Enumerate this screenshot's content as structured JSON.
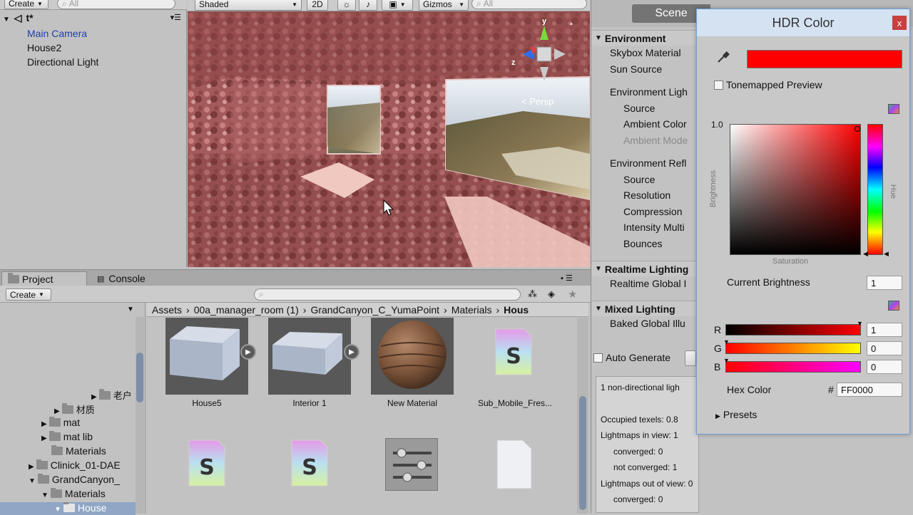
{
  "hierarchy": {
    "create_label": "Create",
    "search_placeholder": "All",
    "scene_name": "t*",
    "items": [
      {
        "label": "Main Camera",
        "color": "#111111"
      },
      {
        "label": "House2",
        "color": "#1f3fb0"
      },
      {
        "label": "Directional Light",
        "color": "#111111"
      }
    ]
  },
  "scene_toolbar": {
    "shading": "Shaded",
    "mode_2d": "2D",
    "gizmos": "Gizmos",
    "search_placeholder": "All"
  },
  "viewport": {
    "persp_label": "Persp",
    "axis_y": "y",
    "axis_z": "z"
  },
  "project": {
    "tab_project": "Project",
    "tab_console": "Console",
    "create_label": "Create",
    "breadcrumb": [
      "Assets",
      "00a_manager_room (1)",
      "GrandCanyon_C_YumaPoint",
      "Materials",
      "Hous"
    ],
    "tree": [
      "老户",
      "材质",
      "mat",
      "mat lib",
      "Materials",
      "Clinick_01-DAE",
      "GrandCanyon_",
      "Materials",
      "House"
    ],
    "assets_row1": [
      "House5",
      "Interior 1",
      "New Material",
      "Sub_Mobile_Fres..."
    ]
  },
  "inspector": {
    "scene_tab": "Scene",
    "environment": {
      "header": "Environment",
      "skybox": "Skybox Material",
      "sun": "Sun Source",
      "env_light": "Environment Ligh",
      "source": "Source",
      "ambient_color": "Ambient Color",
      "ambient_mode": "Ambient Mode",
      "env_refl": "Environment Refl",
      "refl_source": "Source",
      "resolution": "Resolution",
      "compression": "Compression",
      "intensity": "Intensity Multi",
      "bounces": "Bounces"
    },
    "realtime": {
      "header": "Realtime Lighting",
      "gi": "Realtime Global I"
    },
    "mixed": {
      "header": "Mixed Lighting",
      "baked": "Baked Global Illu"
    },
    "auto_generate": "Auto Generate",
    "stats": {
      "line1": "1 non-directional ligh",
      "occupied": "Occupied texels: 0.8",
      "in_view": "Lightmaps in view: 1",
      "converged": "converged: 0",
      "not_converged": "not converged: 1",
      "out_view": "Lightmaps out of view: 0",
      "converged2": "converged: 0"
    }
  },
  "hdr": {
    "title": "HDR Color",
    "close": "x",
    "swatch_color": "#ff0000",
    "tonemapped": "Tonemapped Preview",
    "brightness_label": "Brightness",
    "saturation_label": "Saturation",
    "hue_label": "Hue",
    "max_label": "1.0",
    "current_brightness_label": "Current Brightness",
    "current_brightness": "1",
    "channels": [
      {
        "name": "R",
        "value": "1"
      },
      {
        "name": "G",
        "value": "0"
      },
      {
        "name": "B",
        "value": "0"
      }
    ],
    "hex_label": "Hex Color",
    "hash": "#",
    "hex_value": "FF0000",
    "presets": "Presets"
  }
}
